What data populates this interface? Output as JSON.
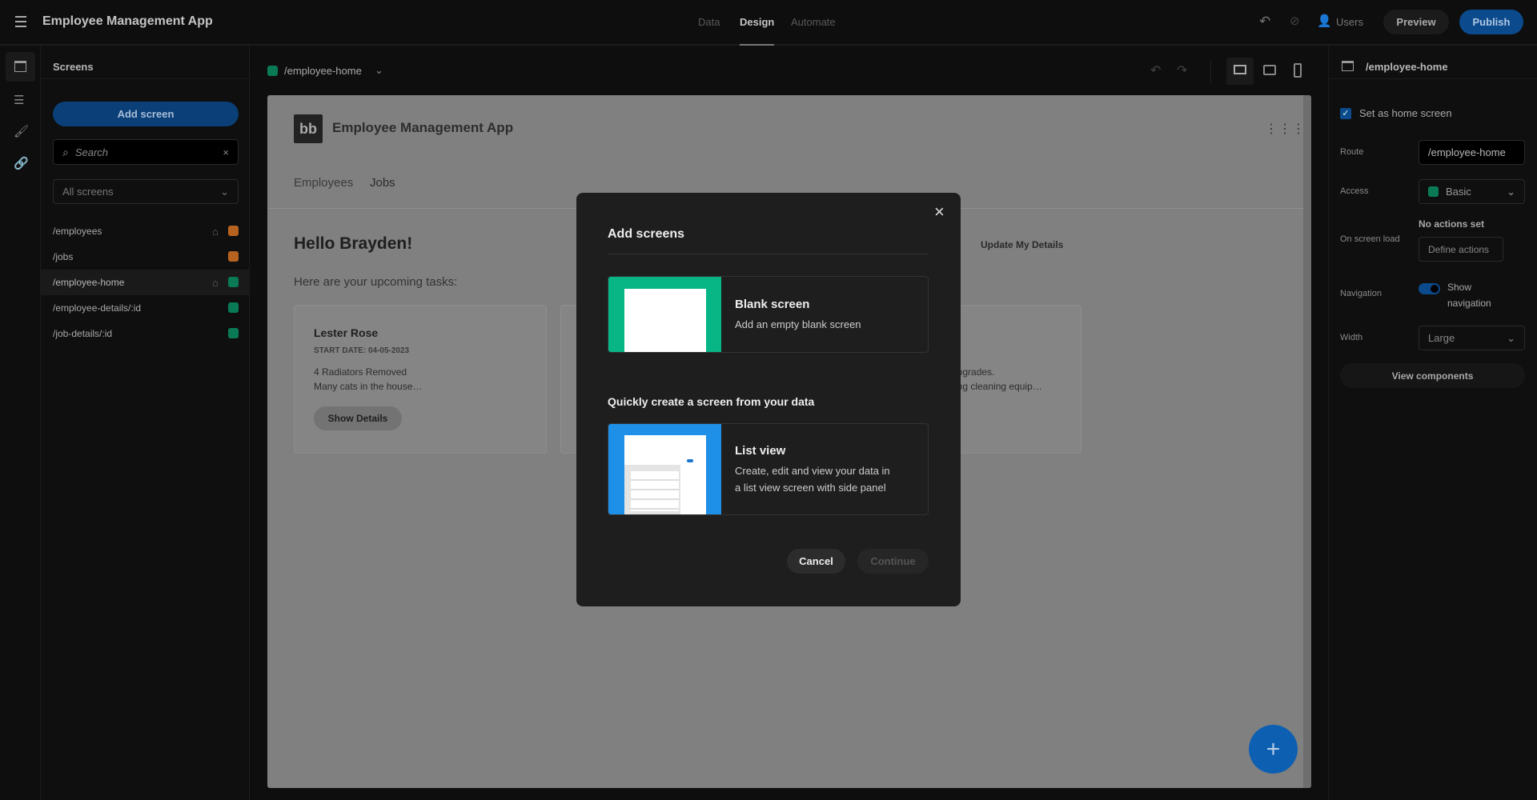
{
  "topbar": {
    "app_title": "Employee Management App",
    "tabs": [
      "Data",
      "Design",
      "Automate"
    ],
    "active_tab": "Design",
    "users_label": "Users",
    "preview_label": "Preview",
    "publish_label": "Publish"
  },
  "screens_panel": {
    "title": "Screens",
    "add_label": "Add screen",
    "search_placeholder": "Search",
    "filter_value": "All screens",
    "items": [
      {
        "route": "/employees",
        "home": true,
        "color": "#b8621f"
      },
      {
        "route": "/jobs",
        "home": false,
        "color": "#b8621f"
      },
      {
        "route": "/employee-home",
        "home": true,
        "color": "#0a7a56",
        "selected": true
      },
      {
        "route": "/employee-details/:id",
        "home": false,
        "color": "#0a7a56"
      },
      {
        "route": "/job-details/:id",
        "home": false,
        "color": "#0a7a56"
      }
    ]
  },
  "canvas": {
    "route": "/employee-home",
    "route_color": "#0a7a56"
  },
  "preview": {
    "app_title": "Employee Management App",
    "nav": [
      "Employees",
      "Jobs"
    ],
    "greeting": "Hello Brayden!",
    "update_link": "Update My Details",
    "subtitle": "Here are your upcoming tasks:",
    "cards": [
      {
        "name": "Lester Rose",
        "start": "START DATE: 04-05-2023",
        "line1": "4 Radiators Removed",
        "line2": "Many cats in the house…",
        "button": "Show Details"
      }
    ],
    "third_card_fragments": [
      "upgrades.",
      "ring cleaning equip…"
    ]
  },
  "modal": {
    "title": "Add screens",
    "blank_title": "Blank screen",
    "blank_desc": "Add an empty blank screen",
    "section": "Quickly create a screen from your data",
    "list_title": "List view",
    "list_desc1": "Create, edit and view your data in",
    "list_desc2": "a list view screen with side panel",
    "cancel": "Cancel",
    "continue": "Continue",
    "blank_color": "#07b585",
    "list_color": "#1e90e8"
  },
  "right_panel": {
    "title": "/employee-home",
    "home_checkbox": "Set as home screen",
    "home_checked": true,
    "route_label": "Route",
    "route_value": "/employee-home",
    "access_label": "Access",
    "access_value": "Basic",
    "load_label": "On screen load",
    "no_actions": "No actions set",
    "define_actions": "Define actions",
    "nav_label": "Navigation",
    "show_nav1": "Show",
    "show_nav2": "navigation",
    "show_nav_on": true,
    "width_label": "Width",
    "width_value": "Large",
    "view_components": "View components"
  }
}
